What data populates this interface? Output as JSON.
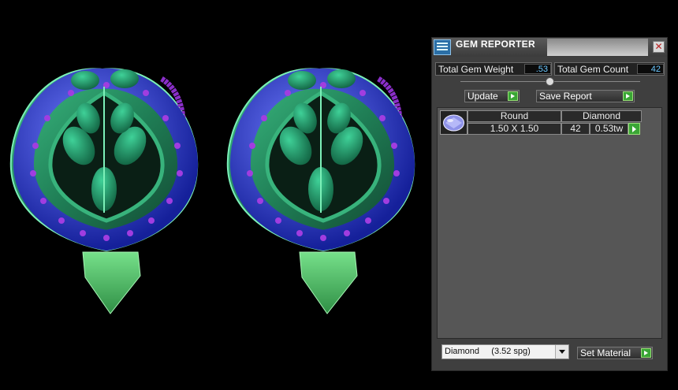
{
  "panel": {
    "title": "GEM REPORTER",
    "title_icon": "gem-reporter-app-icon",
    "close_icon": "close-icon",
    "total_weight_label": "Total Gem Weight",
    "total_weight_value": ".53",
    "total_count_label": "Total Gem Count",
    "total_count_value": "42",
    "update_label": "Update",
    "save_report_label": "Save Report",
    "gem": {
      "thumbnail_icon": "round-gem-icon",
      "shape": "Round",
      "material": "Diamond",
      "size": "1.50 X 1.50",
      "count": "42",
      "weight": "0.53tw"
    },
    "material_select_value": "Diamond     (3.52 spg)",
    "set_material_label": "Set Material",
    "colors": {
      "accent_green": "#3aa635",
      "value_blue": "#6cc8ff"
    }
  }
}
